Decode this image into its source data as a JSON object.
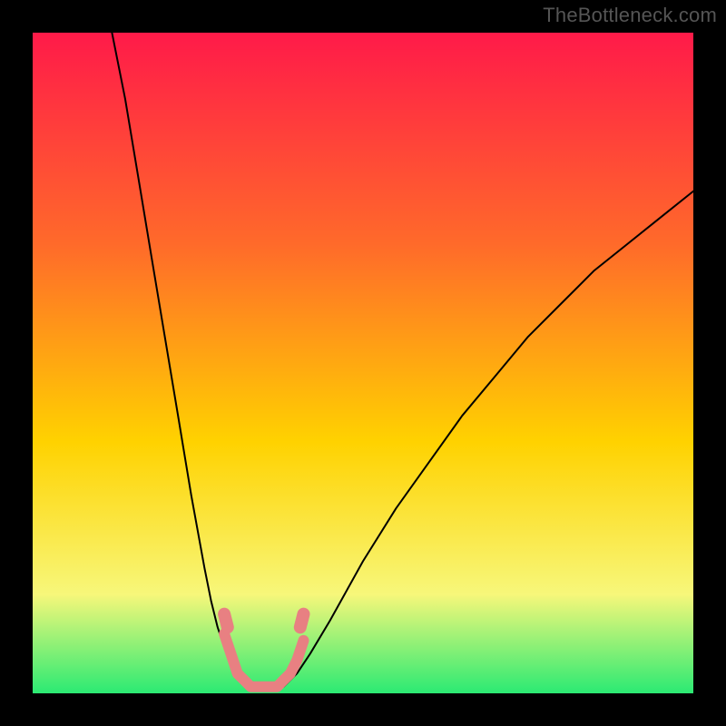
{
  "watermark": "TheBottleneck.com",
  "chart_data": {
    "type": "line",
    "title": "",
    "xlabel": "",
    "ylabel": "",
    "xlim": [
      0,
      100
    ],
    "ylim": [
      0,
      100
    ],
    "grid": false,
    "legend": false,
    "background_gradient": {
      "top": "#ff1a49",
      "mid1": "#ff6a2a",
      "mid2": "#ffd200",
      "mid3": "#f7f77a",
      "bottom": "#2bea73"
    },
    "series": [
      {
        "name": "left_curve",
        "stroke": "#000000",
        "stroke_width": 2,
        "x": [
          12,
          14,
          16,
          18,
          20,
          22,
          24,
          26,
          27,
          28,
          29,
          30,
          31,
          32,
          33
        ],
        "y": [
          100,
          90,
          78,
          66,
          54,
          42,
          30,
          19,
          14,
          10,
          7,
          5,
          3,
          2,
          1
        ]
      },
      {
        "name": "right_curve",
        "stroke": "#000000",
        "stroke_width": 2,
        "x": [
          38,
          40,
          42,
          45,
          50,
          55,
          60,
          65,
          70,
          75,
          80,
          85,
          90,
          95,
          100
        ],
        "y": [
          1,
          3,
          6,
          11,
          20,
          28,
          35,
          42,
          48,
          54,
          59,
          64,
          68,
          72,
          76
        ]
      },
      {
        "name": "valley_floor",
        "stroke": "#e88082",
        "stroke_width": 12,
        "x": [
          29,
          30,
          31,
          32,
          33,
          34,
          35,
          36,
          37,
          38,
          39,
          40,
          41
        ],
        "y": [
          9,
          6,
          3,
          2,
          1,
          1,
          1,
          1,
          1,
          2,
          3,
          5,
          8
        ]
      },
      {
        "name": "valley_knob_left",
        "stroke": "#e88082",
        "stroke_width": 14,
        "x": [
          29,
          29.5
        ],
        "y": [
          12,
          10
        ]
      },
      {
        "name": "valley_knob_right",
        "stroke": "#e88082",
        "stroke_width": 14,
        "x": [
          40.5,
          41
        ],
        "y": [
          10,
          12
        ]
      }
    ]
  }
}
